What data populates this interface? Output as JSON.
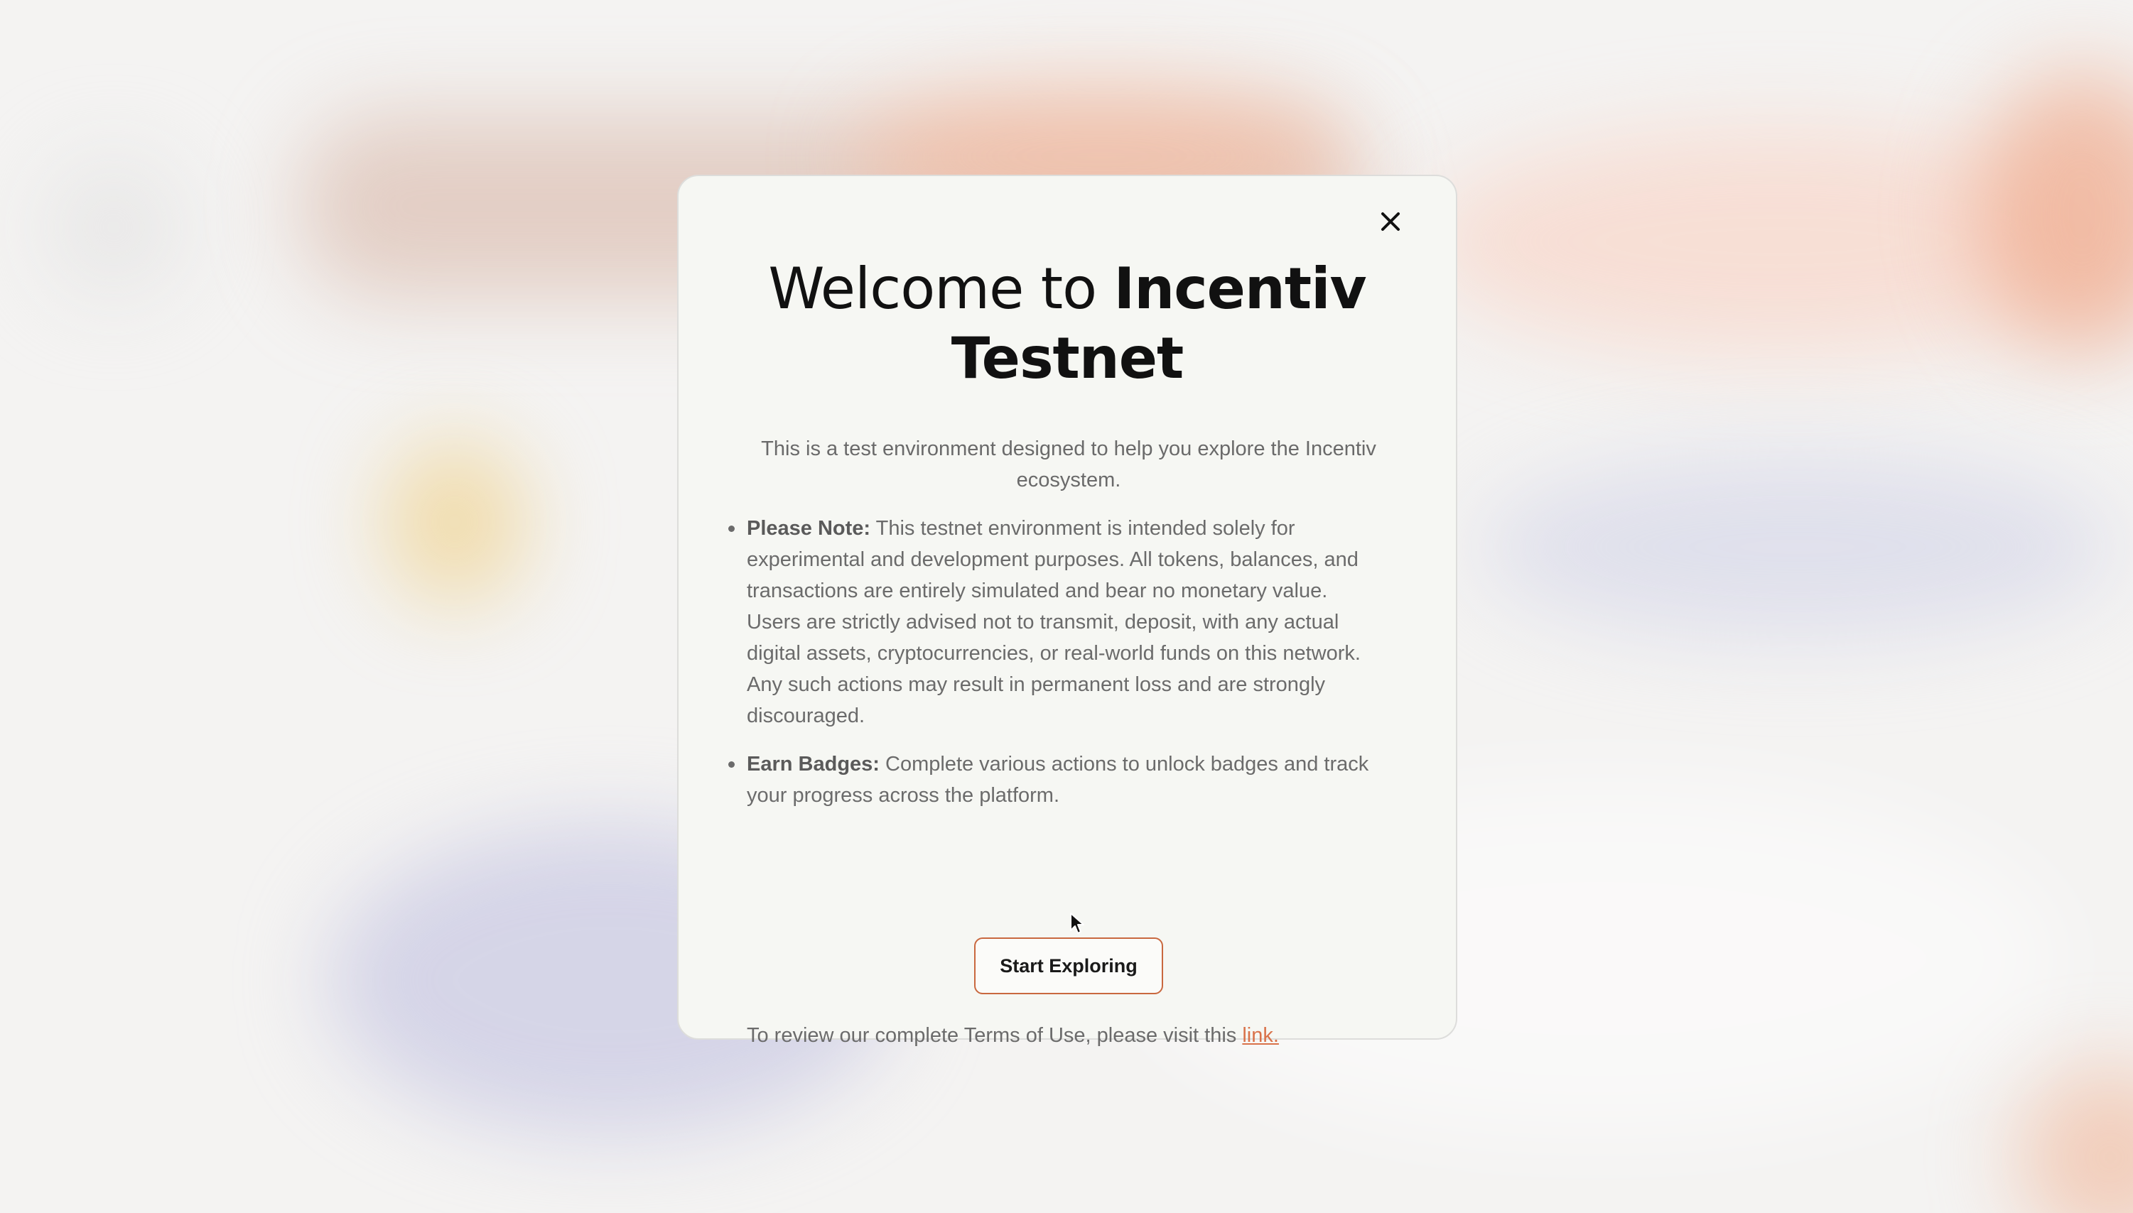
{
  "modal": {
    "close_icon": "close-icon",
    "title_light": "Welcome to ",
    "title_bold_1": "Incentiv",
    "title_bold_2": "Testnet",
    "intro": "This is a test environment designed to help you explore the Incentiv ecosystem.",
    "notes": [
      {
        "lead": "Please Note:",
        "text": " This testnet environment is intended solely for experimental and development purposes. All tokens, balances, and transactions are entirely simulated and bear no monetary value. Users are strictly advised not to transmit, deposit, with any actual digital assets, cryptocurrencies, or real-world funds on this network. Any such actions may result in permanent loss and are strongly discouraged."
      },
      {
        "lead": "Earn Badges:",
        "text": " Complete various actions to unlock badges and track your progress across the platform."
      }
    ],
    "terms_text": "To review our complete Terms of Use, please visit this ",
    "terms_link": "link.",
    "start_button": "Start Exploring"
  },
  "colors": {
    "accent": "#d9724a",
    "button_border": "#c9683f",
    "modal_bg": "#f6f7f3"
  }
}
